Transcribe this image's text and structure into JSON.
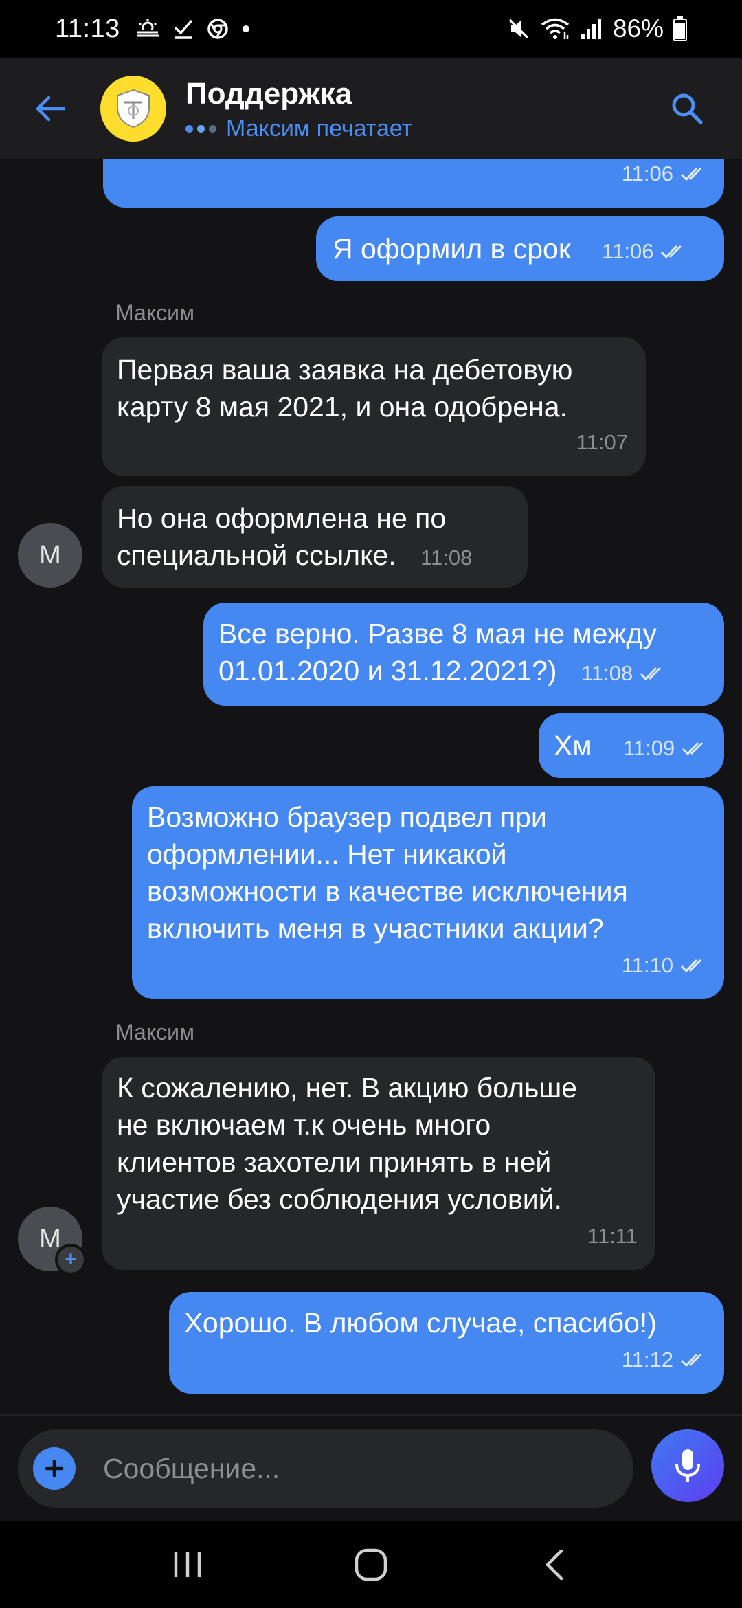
{
  "status_bar": {
    "time": "11:13",
    "battery": "86%",
    "icons_left": [
      "weather-icon",
      "check-icon",
      "chrome-icon",
      "dot-icon"
    ],
    "icons_right": [
      "mute-icon",
      "wifi-icon",
      "signal-icon",
      "battery-icon"
    ]
  },
  "header": {
    "title": "Поддержка",
    "typing_status": "Максим печатает",
    "accent_color": "#4a8ef6",
    "logo_color": "#ffdd2d"
  },
  "messages": [
    {
      "id": 1,
      "direction": "out",
      "text": "",
      "time": "11:06",
      "read": true
    },
    {
      "id": 2,
      "direction": "out",
      "text": "Я оформил в срок",
      "time": "11:06",
      "read": true
    },
    {
      "id": 3,
      "direction": "in",
      "sender": "Максим",
      "text_lines": [
        "Первая ваша заявка на дебетовую",
        "карту 8 мая 2021, и она одобрена."
      ],
      "time": "11:07"
    },
    {
      "id": 4,
      "direction": "in",
      "avatar": "М",
      "text_lines": [
        "Но она оформлена не по",
        "специальной ссылке."
      ],
      "time": "11:08"
    },
    {
      "id": 5,
      "direction": "out",
      "text_lines": [
        "Все верно. Разве 8 мая не между",
        "01.01.2020 и 31.12.2021?)"
      ],
      "time": "11:08",
      "read": true
    },
    {
      "id": 6,
      "direction": "out",
      "text": "Хм",
      "time": "11:09",
      "read": true
    },
    {
      "id": 7,
      "direction": "out",
      "text_lines": [
        "Возможно браузер подвел при",
        "оформлении... Нет никакой",
        "возможности в качестве исключения",
        "включить меня в участники акции?"
      ],
      "time": "11:10",
      "read": true
    },
    {
      "id": 8,
      "direction": "in",
      "sender": "Максим",
      "avatar": "М",
      "text_lines": [
        "К сожалению, нет. В акцию больше",
        "не включаем т.к очень много",
        "клиентов захотели принять в ней",
        "участие без соблюдения условий."
      ],
      "time": "11:11"
    },
    {
      "id": 9,
      "direction": "out",
      "text": "Хорошо. В любом случае, спасибо!)",
      "time": "11:12",
      "read": true
    }
  ],
  "composer": {
    "placeholder": "Сообщение..."
  },
  "colors": {
    "outgoing_bubble": "#4688f1",
    "incoming_bubble": "#26272a",
    "background": "#131315"
  }
}
